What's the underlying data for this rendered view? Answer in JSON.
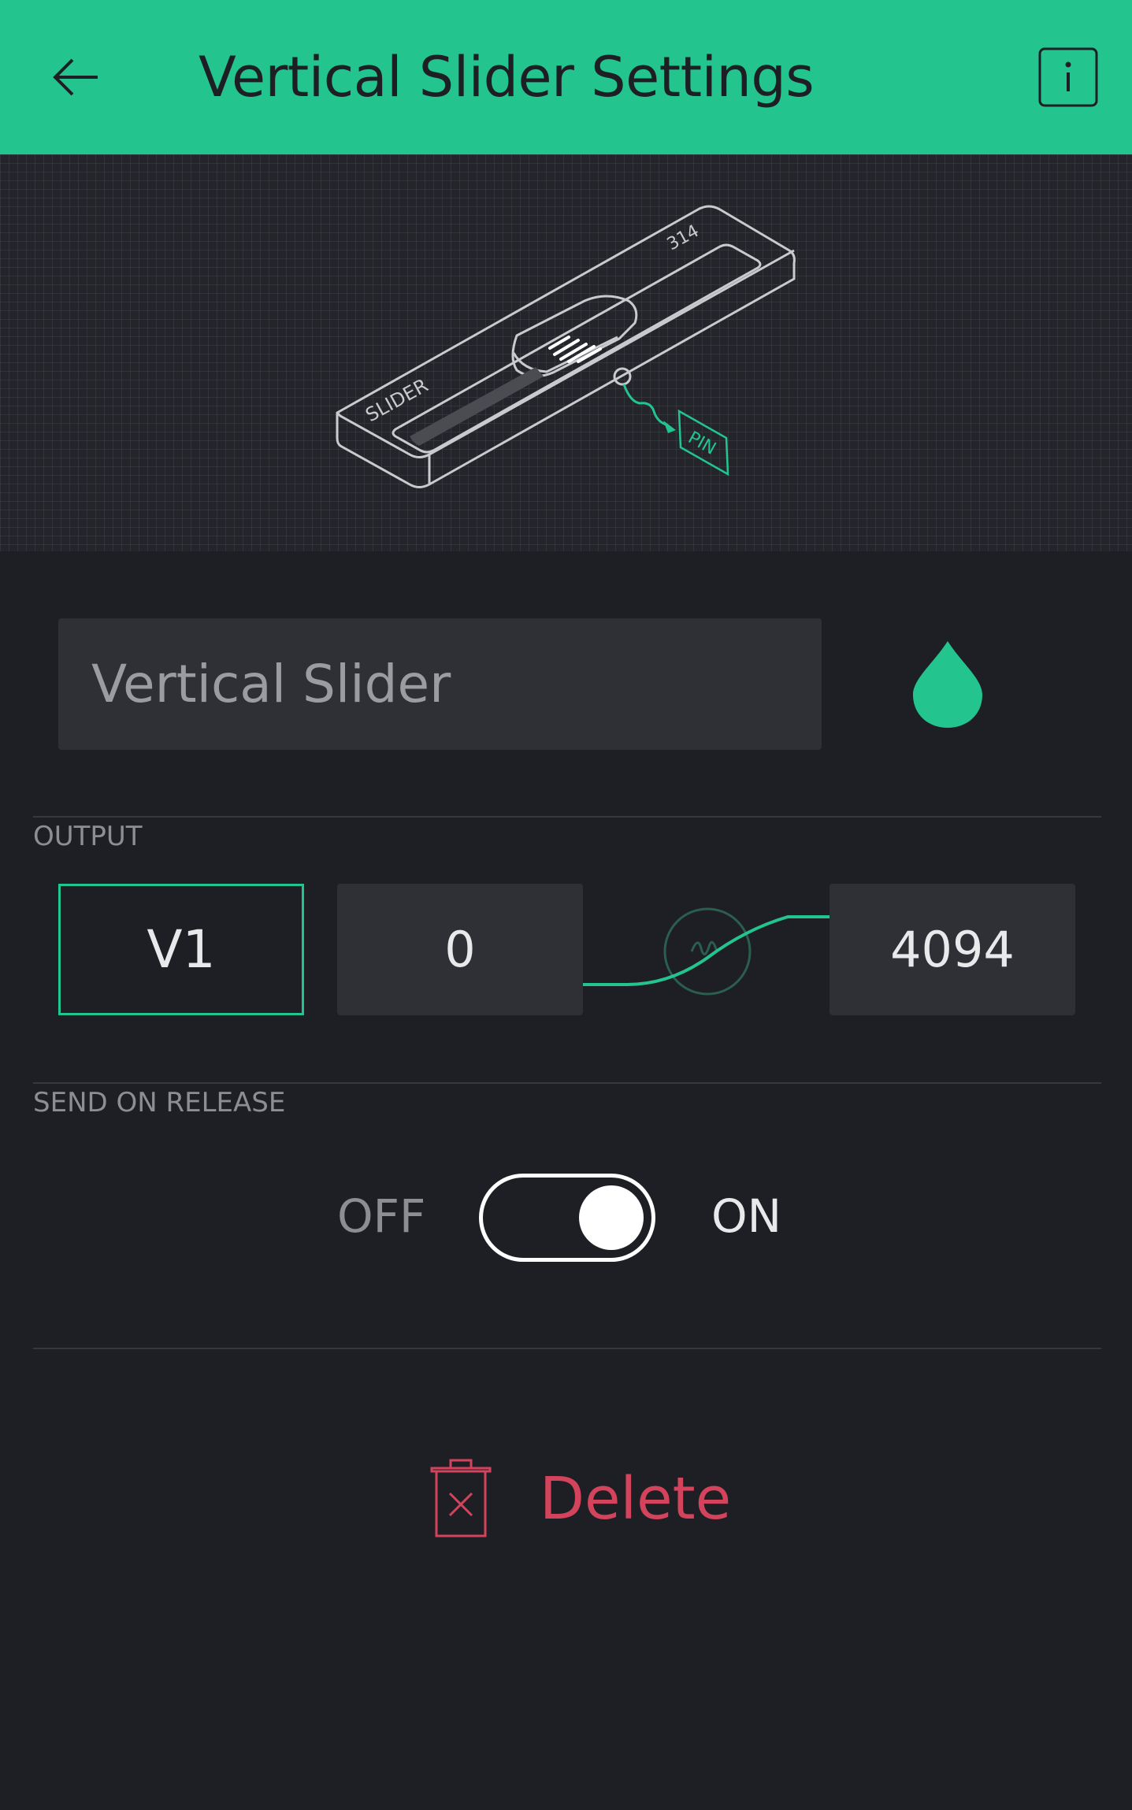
{
  "header": {
    "title": "Vertical Slider Settings",
    "back_icon": "arrow-left-icon",
    "info_icon": "info-icon",
    "background_color": "#23c48e"
  },
  "preview": {
    "slider_label": "SLIDER",
    "value_label": "314",
    "pin_label": "PIN"
  },
  "name_field": {
    "value": "Vertical Slider",
    "color": "#23c48e"
  },
  "output": {
    "label": "OUTPUT",
    "pin": "V1",
    "min": "0",
    "max": "4094"
  },
  "send_on_release": {
    "label": "SEND ON RELEASE",
    "off_label": "OFF",
    "on_label": "ON",
    "state": "ON"
  },
  "delete": {
    "label": "Delete",
    "icon": "trash-icon",
    "color": "#d3435c"
  }
}
